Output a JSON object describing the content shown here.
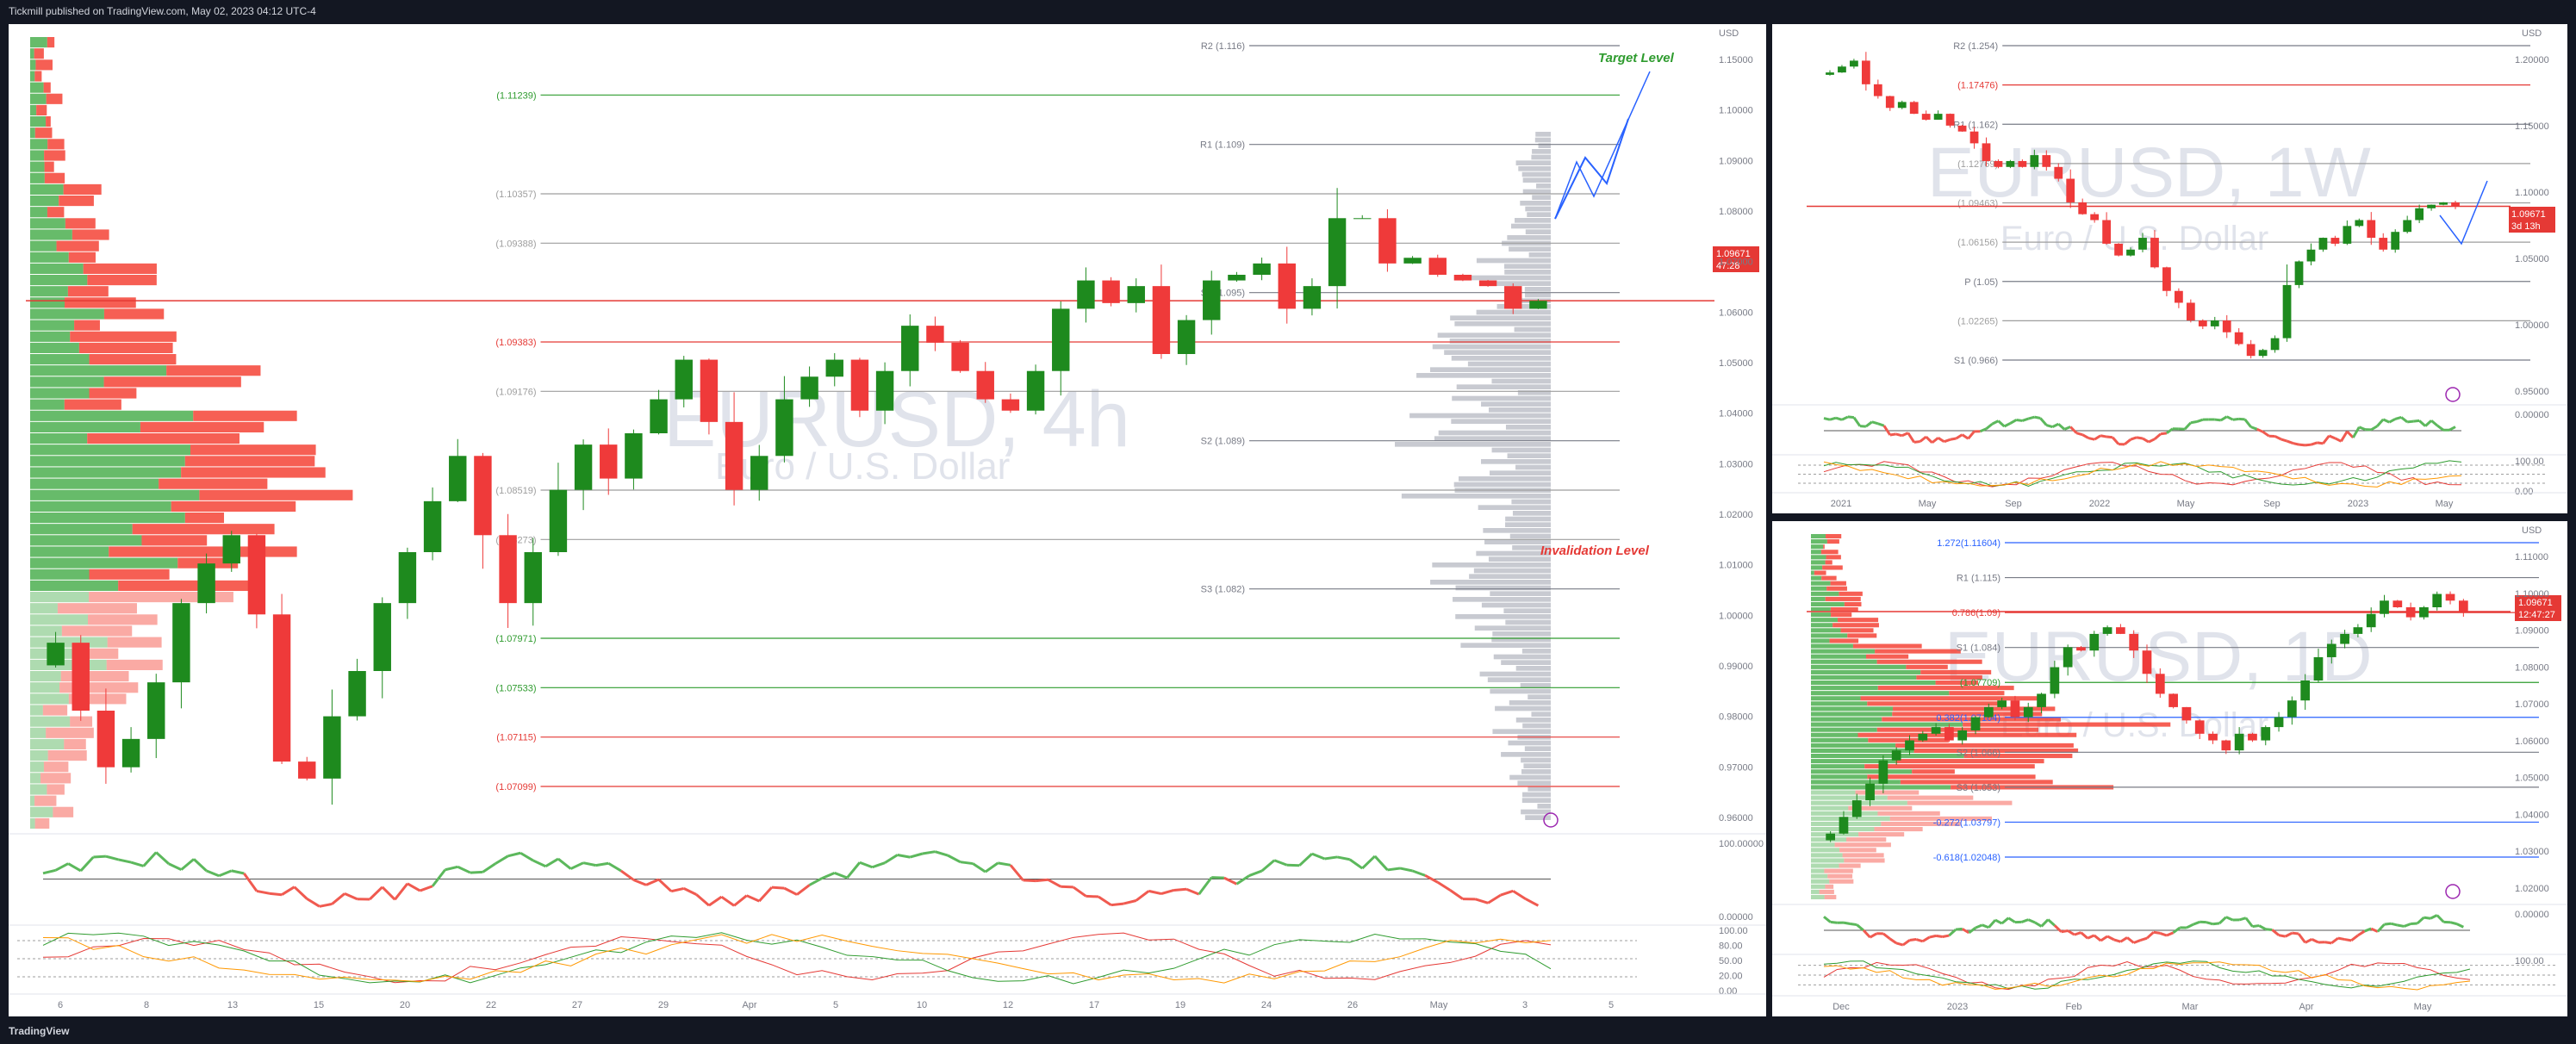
{
  "header": {
    "publish_line": "Tickmill published on TradingView.com, May 02, 2023 04:12 UTC-4"
  },
  "footer": {
    "logo_text": "TradingView"
  },
  "colors": {
    "up": "#1e8a1e",
    "down": "#ef3a3a",
    "vol_up": "#4caf50",
    "vol_down": "#f44336",
    "target": "#2e9b2e",
    "invalidation": "#e53935",
    "projection": "#2962ff",
    "osc_green": "#5cb85c",
    "osc_red": "#f05a50"
  },
  "panels": {
    "main": {
      "watermark_symbol": "EURUSD, 4h",
      "watermark_name": "Euro / U.S. Dollar",
      "target_label": "Target Level",
      "invalidation_label": "Invalidation Level",
      "price_tag": "1.09671",
      "countdown": "47:28",
      "currency": "USD",
      "x_ticks": [
        "6",
        "8",
        "13",
        "15",
        "20",
        "22",
        "27",
        "29",
        "Apr",
        "5",
        "10",
        "12",
        "17",
        "19",
        "24",
        "26",
        "May",
        "3",
        "5"
      ],
      "y_ticks": [
        "1.15000",
        "1.10000",
        "1.09000",
        "1.08000",
        "1.07000",
        "1.06000",
        "1.05000",
        "1.04000",
        "1.03000",
        "1.02000",
        "1.01000",
        "1.00000",
        "0.99000",
        "0.98000",
        "0.97000",
        "0.96000"
      ],
      "levels": [
        {
          "label": "R2 (1.116)",
          "color": "#787b86"
        },
        {
          "label": "(1.11239)",
          "color": "#2e9b2e"
        },
        {
          "label": "R1 (1.109)",
          "color": "#787b86"
        },
        {
          "label": "(1.10357)",
          "color": "#9e9e9e"
        },
        {
          "label": "(1.09388)",
          "color": "#9e9e9e"
        },
        {
          "label": "S1 (1.095)",
          "color": "#787b86"
        },
        {
          "label": "(1.09383)",
          "color": "#e53935"
        },
        {
          "label": "(1.09176)",
          "color": "#9e9e9e"
        },
        {
          "label": "S2 (1.089)",
          "color": "#787b86"
        },
        {
          "label": "(1.08519)",
          "color": "#9e9e9e"
        },
        {
          "label": "(1.08273)",
          "color": "#9e9e9e"
        },
        {
          "label": "S3 (1.082)",
          "color": "#787b86"
        },
        {
          "label": "(1.07971)",
          "color": "#2e9b2e"
        },
        {
          "label": "(1.07533)",
          "color": "#2e9b2e"
        },
        {
          "label": "(1.07115)",
          "color": "#e53935"
        },
        {
          "label": "(1.07099)",
          "color": "#e53935"
        }
      ],
      "osc1_ticks": [
        "100.00000",
        "0.00000"
      ],
      "osc2_ticks": [
        "100.00",
        "80.00",
        "50.00",
        "20.00",
        "0.00"
      ]
    },
    "weekly": {
      "watermark_symbol": "EURUSD, 1W",
      "watermark_name": "Euro / U.S. Dollar",
      "price_tag": "1.09671",
      "countdown": "3d 13h",
      "currency": "USD",
      "x_ticks": [
        "2021",
        "May",
        "Sep",
        "2022",
        "May",
        "Sep",
        "2023",
        "May"
      ],
      "y_ticks": [
        "1.20000",
        "1.15000",
        "1.10000",
        "1.05000",
        "1.00000",
        "0.95000"
      ],
      "levels": [
        {
          "label": "R2 (1.254)",
          "color": "#787b86"
        },
        {
          "label": "(1.17476)",
          "color": "#e53935"
        },
        {
          "label": "R1 (1.162)",
          "color": "#787b86"
        },
        {
          "label": "(1.12769)",
          "color": "#9e9e9e"
        },
        {
          "label": "(1.09463)",
          "color": "#9e9e9e"
        },
        {
          "label": "(1.06156)",
          "color": "#9e9e9e"
        },
        {
          "label": "P (1.05)",
          "color": "#787b86"
        },
        {
          "label": "(1.02265)",
          "color": "#9e9e9e"
        },
        {
          "label": "S1 (0.966)",
          "color": "#787b86"
        }
      ],
      "osc1_ticks": [
        "0.00000"
      ],
      "osc2_ticks": [
        "100.00",
        "0.00"
      ]
    },
    "daily": {
      "watermark_symbol": "EURUSD, 1D",
      "watermark_name": "Euro / U.S. Dollar",
      "price_tag": "1.09671",
      "countdown": "12:47:27",
      "currency": "USD",
      "x_ticks": [
        "Dec",
        "2023",
        "Feb",
        "Mar",
        "Apr",
        "May"
      ],
      "y_ticks": [
        "1.11000",
        "1.10000",
        "1.09000",
        "1.08000",
        "1.07000",
        "1.06000",
        "1.05000",
        "1.04000",
        "1.03000",
        "1.02000"
      ],
      "levels": [
        {
          "label": "1.272(1.11604)",
          "color": "#2962ff"
        },
        {
          "label": "R1 (1.115)",
          "color": "#787b86"
        },
        {
          "label": "0.786(1.09)",
          "color": "#e53935"
        },
        {
          "label": "S1 (1.084)",
          "color": "#787b86"
        },
        {
          "label": "(1.07709)",
          "color": "#2e9b2e"
        },
        {
          "label": "0.382(1.07104)",
          "color": "#2962ff"
        },
        {
          "label": "S2 (1.066)",
          "color": "#787b86"
        },
        {
          "label": "S3 (1.053)",
          "color": "#787b86"
        },
        {
          "label": "-0.272(1.03797)",
          "color": "#2962ff"
        },
        {
          "label": "-0.618(1.02048)",
          "color": "#2962ff"
        }
      ],
      "osc1_ticks": [
        "0.00000"
      ],
      "osc2_ticks": [
        "100.00"
      ]
    }
  },
  "chart_data": [
    {
      "type": "candlestick",
      "symbol": "EURUSD",
      "timeframe": "4h",
      "title": "EURUSD, 4h",
      "subtitle": "Euro / U.S. Dollar",
      "y_unit": "USD",
      "ylim": [
        1.05,
        1.12
      ],
      "x_range": [
        "Mar 3",
        "May 5"
      ],
      "last_price": 1.09671,
      "series": [
        {
          "name": "",
          "values": [
            1.0665,
            1.0605,
            1.0555,
            1.058,
            1.063,
            1.07,
            1.0735,
            1.076,
            1.069,
            1.056,
            1.0545,
            1.06,
            1.064,
            1.07,
            1.0745,
            1.079,
            1.083,
            1.076,
            1.07,
            1.0745,
            1.08,
            1.084,
            1.081,
            1.085,
            1.088,
            1.0915,
            1.086,
            1.08,
            1.083,
            1.088,
            1.09,
            1.0915,
            1.087,
            1.0905,
            1.0945,
            1.093,
            1.0905,
            1.088,
            1.087,
            1.0905,
            1.096,
            1.0985,
            1.0965,
            1.098,
            1.092,
            1.095,
            1.0985,
            1.099,
            1.1,
            1.096,
            1.098,
            1.104,
            1.104,
            1.1,
            1.1005,
            1.099,
            1.0985,
            1.098,
            1.096,
            1.0967
          ]
        }
      ]
    },
    {
      "type": "candlestick",
      "symbol": "EURUSD",
      "timeframe": "1W",
      "title": "EURUSD, 1W",
      "subtitle": "Euro / U.S. Dollar",
      "y_unit": "USD",
      "ylim": [
        0.93,
        1.24
      ],
      "last_price": 1.09671,
      "series": [
        {
          "name": "",
          "values": [
            1.21,
            1.215,
            1.22,
            1.2,
            1.19,
            1.18,
            1.185,
            1.175,
            1.17,
            1.175,
            1.165,
            1.16,
            1.15,
            1.135,
            1.13,
            1.135,
            1.13,
            1.14,
            1.13,
            1.12,
            1.1,
            1.09,
            1.085,
            1.065,
            1.055,
            1.06,
            1.07,
            1.045,
            1.025,
            1.015,
            1.0,
            0.995,
            1.0,
            0.99,
            0.98,
            0.97,
            0.975,
            0.985,
            1.03,
            1.05,
            1.06,
            1.07,
            1.065,
            1.08,
            1.085,
            1.07,
            1.06,
            1.075,
            1.085,
            1.095,
            1.098,
            1.1,
            1.0967
          ]
        }
      ]
    },
    {
      "type": "candlestick",
      "symbol": "EURUSD",
      "timeframe": "1D",
      "title": "EURUSD, 1D",
      "subtitle": "Euro / U.S. Dollar",
      "y_unit": "USD",
      "ylim": [
        1.01,
        1.12
      ],
      "last_price": 1.09671,
      "series": [
        {
          "name": "",
          "values": [
            1.03,
            1.035,
            1.04,
            1.045,
            1.052,
            1.055,
            1.058,
            1.06,
            1.062,
            1.058,
            1.061,
            1.065,
            1.068,
            1.07,
            1.065,
            1.068,
            1.072,
            1.08,
            1.086,
            1.085,
            1.09,
            1.092,
            1.09,
            1.085,
            1.078,
            1.072,
            1.068,
            1.064,
            1.06,
            1.058,
            1.055,
            1.06,
            1.058,
            1.062,
            1.065,
            1.07,
            1.076,
            1.083,
            1.087,
            1.09,
            1.092,
            1.096,
            1.1,
            1.098,
            1.095,
            1.098,
            1.102,
            1.1,
            1.0967
          ]
        }
      ]
    }
  ]
}
